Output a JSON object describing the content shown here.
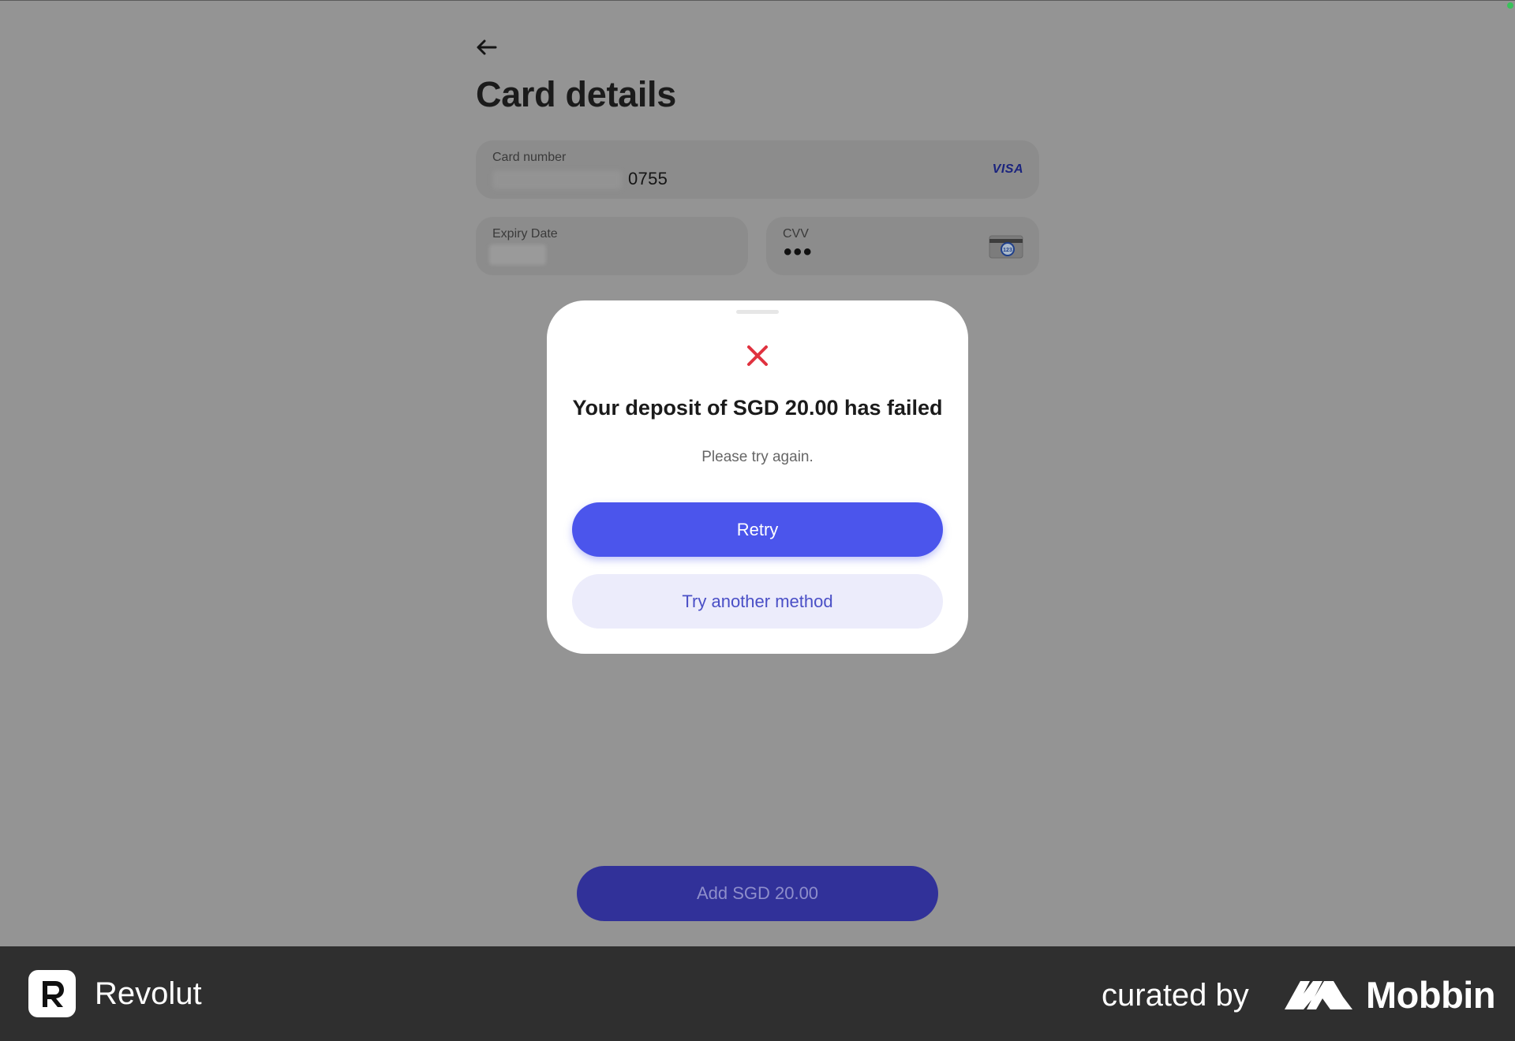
{
  "page": {
    "title": "Card details",
    "fields": {
      "card_number": {
        "label": "Card number",
        "value": "0755",
        "brand": "VISA"
      },
      "expiry": {
        "label": "Expiry Date"
      },
      "cvv": {
        "label": "CVV",
        "value": "•••",
        "icon": "card-cvv-icon"
      }
    },
    "add_button": "Add SGD 20.00"
  },
  "modal": {
    "icon": "error-x-icon",
    "title": "Your deposit of SGD 20.00 has failed",
    "subtitle": "Please try again.",
    "primary_button": "Retry",
    "secondary_button": "Try another method"
  },
  "footer": {
    "app_name": "Revolut",
    "curated_by": "curated by",
    "brand": "Mobbin"
  },
  "colors": {
    "accent": "#4b55ec",
    "error": "#e0323f",
    "overlay": "#949494",
    "footer_bg": "#2f2f2f"
  }
}
